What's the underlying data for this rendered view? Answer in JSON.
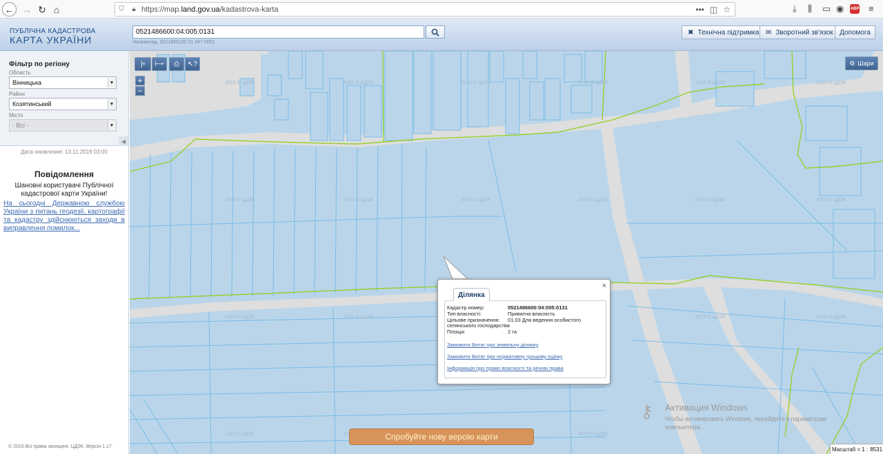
{
  "browser": {
    "url_prefix": "https://map.",
    "url_domain": "land.gov.ua",
    "url_path": "/kadastrova-karta",
    "url_more": "•••"
  },
  "header": {
    "logo_line1": "ПУБЛІЧНА КАДАСТРОВА",
    "logo_line2": "КАРТА УКРАЇНИ",
    "search_value": "0521486600:04:005:0131",
    "search_hint": "Наприклад, 3221655100 01 047 0052",
    "support_label": "Технічна підтримка",
    "feedback_label": "Зворотний зв'язок",
    "help_label": "Допомога"
  },
  "filter": {
    "title": "Фільтр по регіону",
    "oblast_label": "Область",
    "oblast_value": "Вінницька",
    "rayon_label": "Район",
    "rayon_value": "Козятинський",
    "misto_label": "Місто",
    "misto_value": "- Всі -"
  },
  "sidebar": {
    "update_date": "Дата оновлення: 13.11.2019 03:00",
    "notice_title": "Повідомлення",
    "notice_text": "Шановні користувачі Публічної кадастрової карти України!",
    "notice_link": "На сьогодні Державною службою України з питань геодезії, картографії та кадастру здійснюються заходи в виправлення помилок...",
    "copyright": "© 2016 Всі права захищені. ЦДЗК. Версія 1.17."
  },
  "map": {
    "layers_label": "Шари",
    "zoom_in": "+",
    "zoom_out": "−",
    "tool_distance": "м",
    "tool_area": "м²",
    "colors": {
      "land": "#bad5ea",
      "road": "#dedede",
      "parcel_line": "#7bbbe6",
      "boundary": "#96cf2d"
    }
  },
  "popup": {
    "tab_label": "Ділянка",
    "close": "×",
    "rows": [
      {
        "label": "Кадастр.номер:",
        "value": "0521486600:04:005:0131"
      },
      {
        "label": "Тип власності:",
        "value": "Приватна власність"
      },
      {
        "label": "Цільове призначення:",
        "value": "01.03 Для ведення особистого селянського господарства"
      },
      {
        "label": "Площа:",
        "value": "2 га"
      }
    ],
    "links": [
      "Замовити Витяг про земельну ділянку",
      "Замовити Витяг про нормативну грошову оцінку",
      "Інформація про право власності та речові права"
    ]
  },
  "footer": {
    "try_new": "Спробуйте нову версію карти",
    "scale_label": "Масштаб = 1 :",
    "scale_value": "8531"
  },
  "activation": {
    "title": "Активация Windows",
    "text": "Чтобы активировать Windows, перейдите к параметрам компьютера."
  }
}
